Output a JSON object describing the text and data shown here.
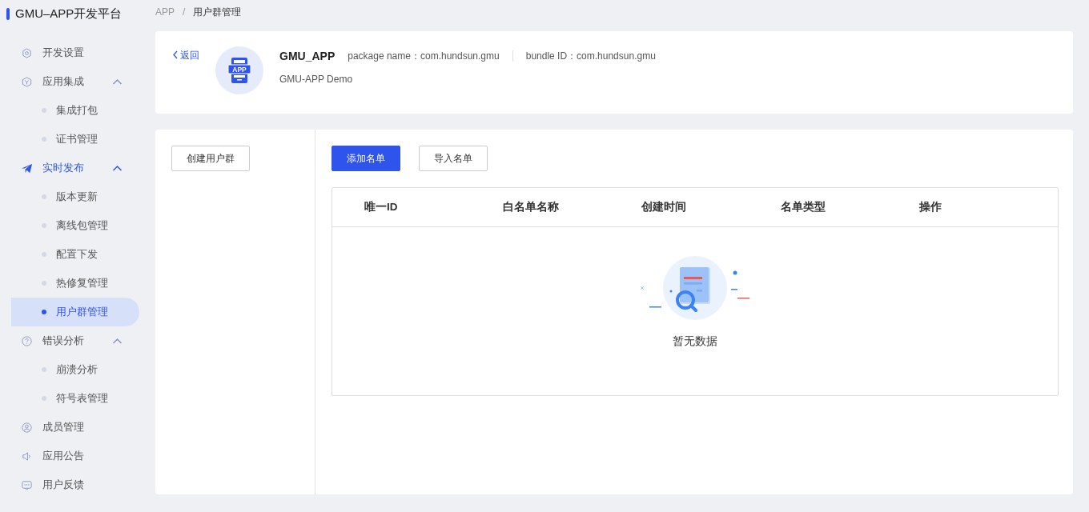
{
  "sidebar": {
    "title": "GMU–APP开发平台",
    "items": [
      {
        "kind": "item",
        "label": "开发设置",
        "selected": false
      },
      {
        "kind": "group",
        "label": "应用集成",
        "expanded": true,
        "selected": false,
        "children": [
          {
            "label": "集成打包",
            "selected": false
          },
          {
            "label": "证书管理",
            "selected": false
          }
        ]
      },
      {
        "kind": "group",
        "label": "实时发布",
        "expanded": true,
        "selected": true,
        "children": [
          {
            "label": "版本更新",
            "selected": false
          },
          {
            "label": "离线包管理",
            "selected": false
          },
          {
            "label": "配置下发",
            "selected": false
          },
          {
            "label": "热修复管理",
            "selected": false
          },
          {
            "label": "用户群管理",
            "selected": true
          }
        ]
      },
      {
        "kind": "group",
        "label": "错误分析",
        "expanded": true,
        "selected": false,
        "children": [
          {
            "label": "崩溃分析",
            "selected": false
          },
          {
            "label": "符号表管理",
            "selected": false
          }
        ]
      },
      {
        "kind": "item",
        "label": "成员管理",
        "selected": false
      },
      {
        "kind": "item",
        "label": "应用公告",
        "selected": false
      },
      {
        "kind": "item",
        "label": "用户反馈",
        "selected": false
      }
    ]
  },
  "breadcrumb": [
    "APP",
    "用户群管理"
  ],
  "breadcrumb_separator": "/",
  "app_card": {
    "back": "返回",
    "icon_text": "APP",
    "name": "GMU_APP",
    "package_label": "package name：",
    "package": "com.hundsun.gmu",
    "bundle_label": "bundle ID：",
    "bundle": "com.hundsun.gmu",
    "description": "GMU-APP Demo"
  },
  "left_pane": {
    "button": "创建用户群"
  },
  "toolbar": {
    "buttons": [
      {
        "label": "添加名单",
        "kind": "primary"
      },
      {
        "label": "导入名单",
        "kind": "default"
      }
    ]
  },
  "table": {
    "columns": [
      "唯一ID",
      "白名单名称",
      "创建时间",
      "名单类型",
      "操作"
    ],
    "empty_text": "暂无数据"
  }
}
